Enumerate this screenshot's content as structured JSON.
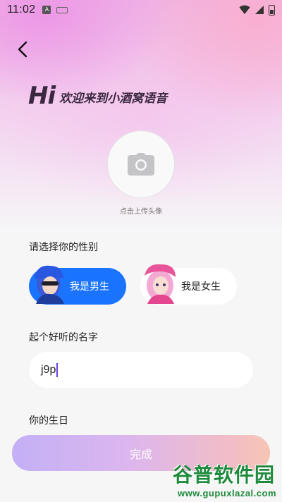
{
  "status_bar": {
    "time": "11:02",
    "app_icon_letter": "A"
  },
  "hero": {
    "hi": "Hi",
    "welcome_text": "欢迎来到小酒窝语音"
  },
  "avatar": {
    "hint": "点击上传头像"
  },
  "gender": {
    "label": "请选择你的性别",
    "options": [
      {
        "label": "我是男生",
        "selected": true,
        "color": "#1a74ff"
      },
      {
        "label": "我是女生",
        "selected": false,
        "color": "#ffffff"
      }
    ]
  },
  "name": {
    "label": "起个好听的名字",
    "value": "j9p"
  },
  "birthday": {
    "label": "你的生日"
  },
  "done": {
    "label": "完成"
  },
  "watermark": {
    "title": "谷普软件园",
    "url": "www.gupuxlazal.com"
  }
}
